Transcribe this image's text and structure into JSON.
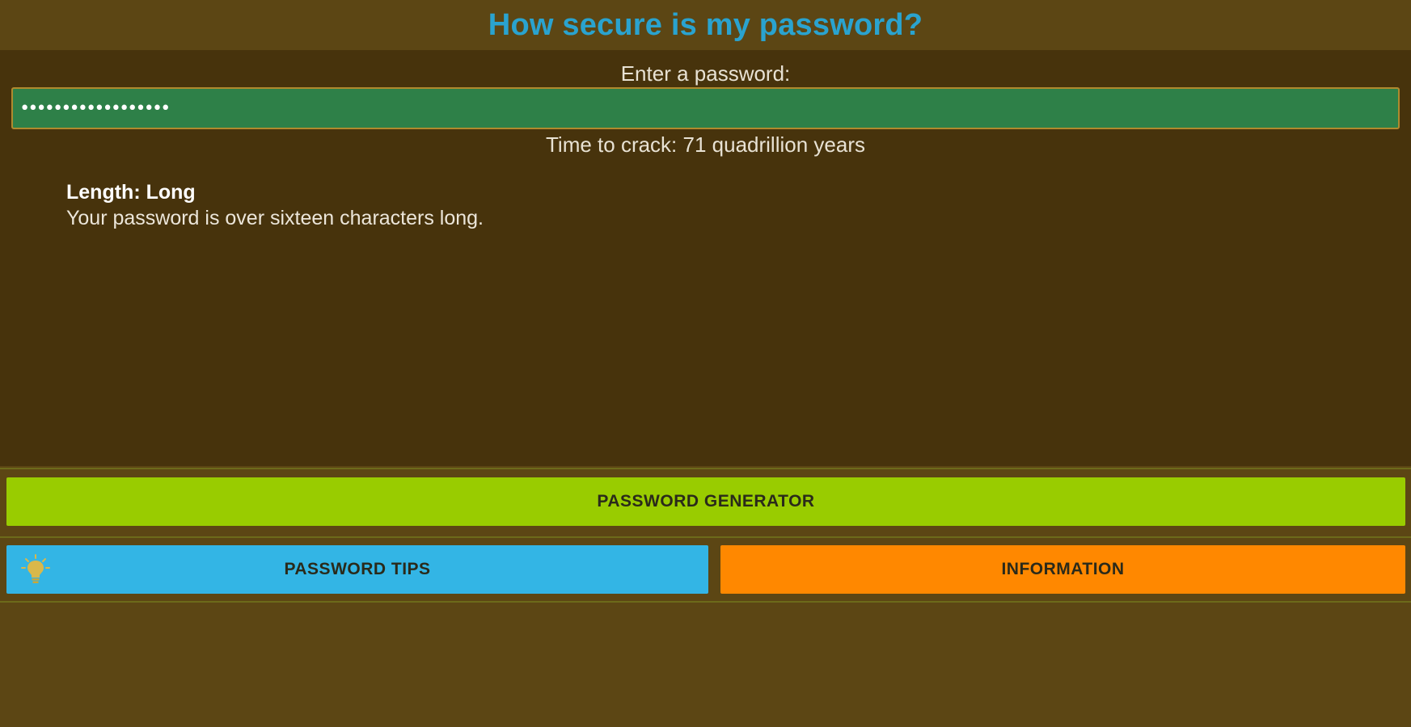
{
  "header": {
    "title": "How secure is my password?"
  },
  "form": {
    "prompt_label": "Enter a password:",
    "password_value": "••••••••••••••••••",
    "time_to_crack": "Time to crack: 71 quadrillion years"
  },
  "feedback": {
    "heading": "Length: Long",
    "description": "Your password is over sixteen characters long."
  },
  "buttons": {
    "generator_label": "PASSWORD GENERATOR",
    "tips_label": "PASSWORD TIPS",
    "tips_icon": "lightbulb-icon",
    "info_label": "INFORMATION"
  },
  "colors": {
    "title": "#2aa3cf",
    "input_background": "#2e8048",
    "generator": "#99cc00",
    "tips": "#33b5e5",
    "info": "#ff8800"
  }
}
